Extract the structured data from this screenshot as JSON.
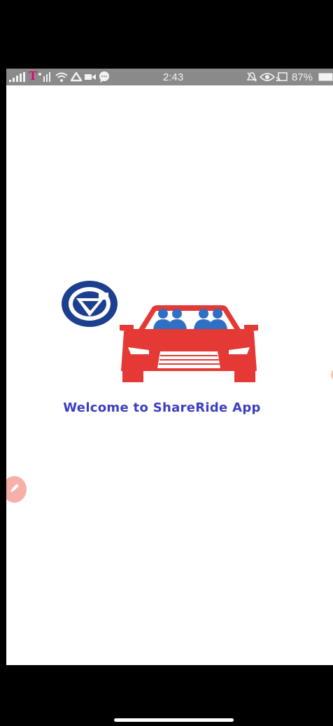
{
  "status_bar": {
    "carrier": "T",
    "time": "2:43",
    "battery_percent": "87%",
    "icons": [
      "signal-icon",
      "wifi-icon",
      "drive-icon",
      "video-icon",
      "chat-icon",
      "mute-icon",
      "eye-icon",
      "cast-icon",
      "battery-icon"
    ]
  },
  "splash": {
    "welcome_text": "Welcome to ShareRide App"
  },
  "colors": {
    "logo_blue": "#1d3f8f",
    "car_red": "#e53935",
    "welcome_text": "#3c3ec2",
    "fab": "#f6b0a8",
    "status_bar": "#8a8a8a"
  }
}
